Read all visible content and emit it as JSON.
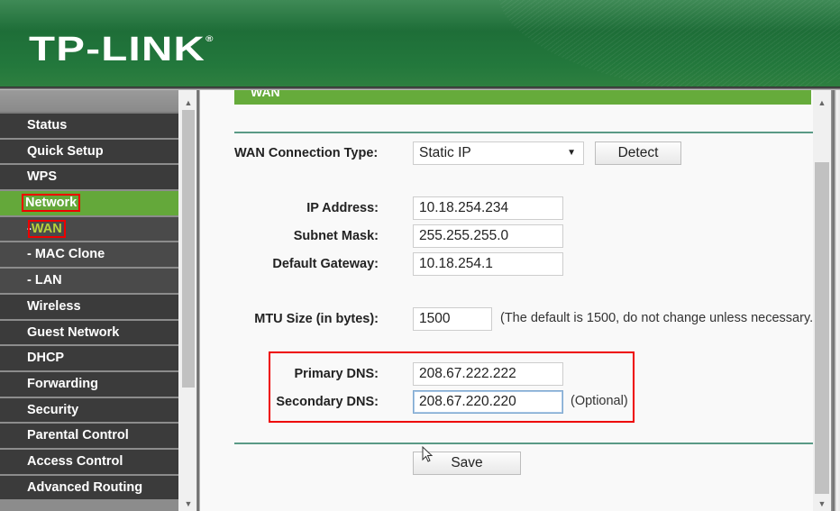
{
  "header": {
    "brand": "TP-LINK",
    "registered_mark": "®"
  },
  "sidebar": {
    "items": [
      {
        "label": "Status",
        "type": "top",
        "state": "normal"
      },
      {
        "label": "Quick Setup",
        "type": "top",
        "state": "normal"
      },
      {
        "label": "WPS",
        "type": "top",
        "state": "normal"
      },
      {
        "label": "Network",
        "type": "top",
        "state": "active"
      },
      {
        "label": "WAN",
        "prefix": "- ",
        "type": "sub",
        "state": "active"
      },
      {
        "label": "- MAC Clone",
        "type": "sub",
        "state": "normal"
      },
      {
        "label": "- LAN",
        "type": "sub",
        "state": "normal"
      },
      {
        "label": "Wireless",
        "type": "top",
        "state": "normal"
      },
      {
        "label": "Guest Network",
        "type": "top",
        "state": "normal"
      },
      {
        "label": "DHCP",
        "type": "top",
        "state": "normal"
      },
      {
        "label": "Forwarding",
        "type": "top",
        "state": "normal"
      },
      {
        "label": "Security",
        "type": "top",
        "state": "normal"
      },
      {
        "label": "Parental Control",
        "type": "top",
        "state": "normal"
      },
      {
        "label": "Access Control",
        "type": "top",
        "state": "normal"
      },
      {
        "label": "Advanced Routing",
        "type": "top",
        "state": "normal"
      }
    ]
  },
  "main": {
    "section_title": "WAN",
    "connection_type": {
      "label": "WAN Connection Type:",
      "value": "Static IP",
      "detect_label": "Detect"
    },
    "ip_address": {
      "label": "IP Address:",
      "value": "10.18.254.234"
    },
    "subnet_mask": {
      "label": "Subnet Mask:",
      "value": "255.255.255.0"
    },
    "default_gateway": {
      "label": "Default Gateway:",
      "value": "10.18.254.1"
    },
    "mtu": {
      "label": "MTU Size (in bytes):",
      "value": "1500",
      "hint": "(The default is 1500, do not change unless necessary.)"
    },
    "primary_dns": {
      "label": "Primary DNS:",
      "value": "208.67.222.222"
    },
    "secondary_dns": {
      "label": "Secondary DNS:",
      "value": "208.67.220.220",
      "hint": "(Optional)"
    },
    "save_label": "Save"
  },
  "colors": {
    "brand_green": "#1e6e38",
    "active_green": "#64a83a",
    "highlight_red": "#e00000",
    "active_sub_text": "#b8d23a"
  }
}
